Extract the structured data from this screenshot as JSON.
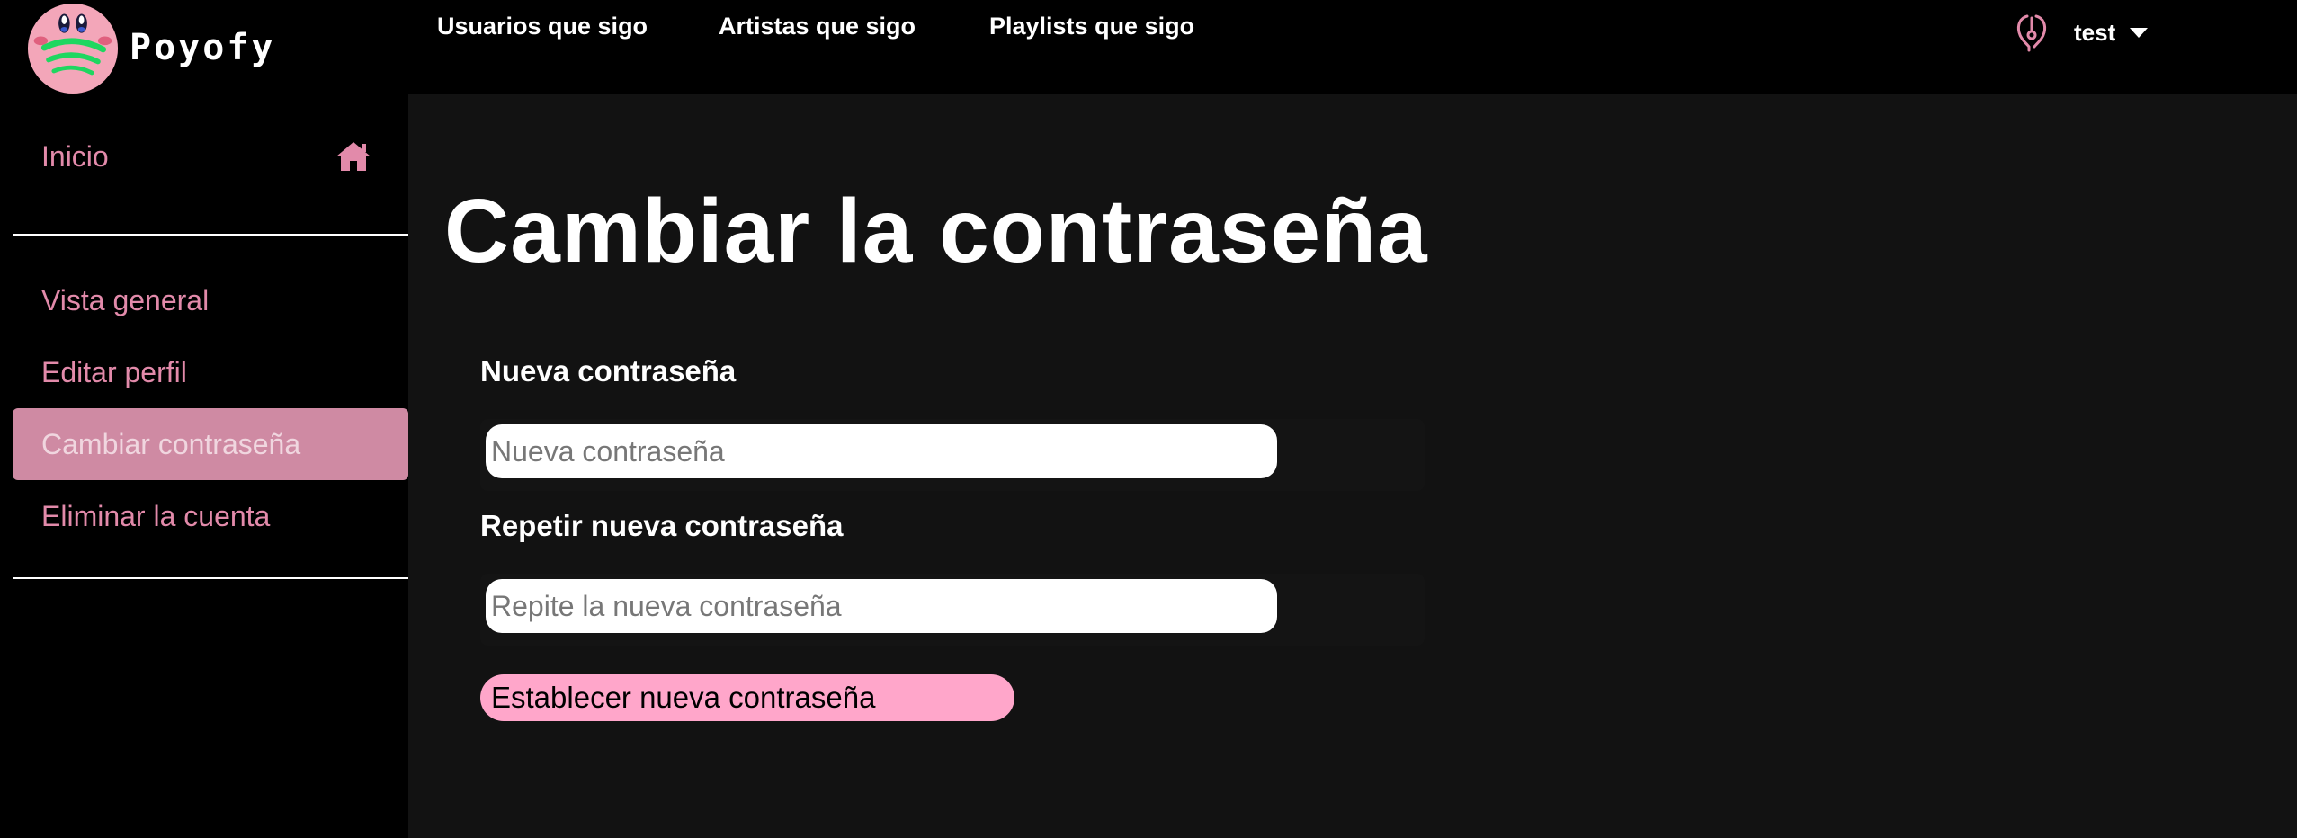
{
  "brand": {
    "name": "Poyofy"
  },
  "topnav": {
    "items": [
      {
        "label": "Usuarios que sigo"
      },
      {
        "label": "Artistas que sigo"
      },
      {
        "label": "Playlists que sigo"
      }
    ]
  },
  "user": {
    "name": "test",
    "icon": "user-icon"
  },
  "sidebar": {
    "home": {
      "label": "Inicio",
      "icon": "home-icon"
    },
    "items": [
      {
        "label": "Vista general"
      },
      {
        "label": "Editar perfil"
      },
      {
        "label": "Cambiar contraseña",
        "active": true
      },
      {
        "label": "Eliminar la cuenta"
      }
    ]
  },
  "page": {
    "title": "Cambiar la contraseña",
    "new_password": {
      "label": "Nueva contraseña",
      "placeholder": "Nueva contraseña",
      "value": ""
    },
    "repeat_password": {
      "label": "Repetir nueva contraseña",
      "placeholder": "Repite la nueva contraseña",
      "value": ""
    },
    "submit_label": "Establecer nueva contraseña"
  },
  "colors": {
    "accent_pink": "#e28aaa",
    "active_bg": "#cf8aa3",
    "button_pink": "#ffa6ca",
    "main_bg": "#121212"
  }
}
